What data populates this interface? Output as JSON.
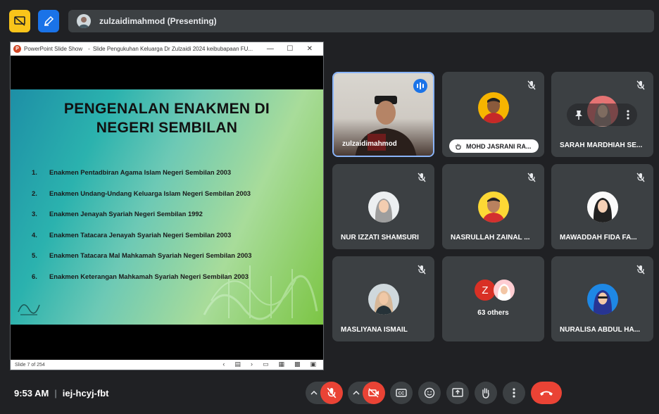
{
  "header": {
    "presenting_title": "zulzaidimahmod (Presenting)"
  },
  "ppt_window": {
    "app_name": "PowerPoint Slide Show",
    "doc_title": "Slide Pengukuhan Keluarga Dr Zulzaidi 2024 keibubapaan FU...",
    "minimize": "—",
    "maximize": "☐",
    "close": "✕",
    "status": "Slide 7 of 254"
  },
  "slide": {
    "title_line1": "PENGENALAN ENAKMEN DI",
    "title_line2": "NEGERI SEMBILAN",
    "items": [
      {
        "num": "1.",
        "text": "Enakmen Pentadbiran Agama Islam Negeri Sembilan 2003"
      },
      {
        "num": "2.",
        "text": "Enakmen Undang-Undang Keluarga Islam Negeri Sembilan 2003"
      },
      {
        "num": "3.",
        "text": "Enakmen Jenayah Syariah Negeri Sembilan 1992"
      },
      {
        "num": "4.",
        "text": "Enakmen Tatacara Jenayah Syariah Negeri Sembilan 2003"
      },
      {
        "num": "5.",
        "text": "Enakmen Tatacara Mal Mahkamah Syariah Negeri Sembilan 2003"
      },
      {
        "num": "6.",
        "text": "Enakmen Keterangan Mahkamah Syariah Negeri Sembilan 2003"
      }
    ]
  },
  "participants": [
    {
      "name": "zulzaidimahmod"
    },
    {
      "name": "MOHD JASRANI RA..."
    },
    {
      "name": "SARAH MARDHIAH SE..."
    },
    {
      "name": "NUR IZZATI SHAMSURI"
    },
    {
      "name": "NASRULLAH ZAINAL ..."
    },
    {
      "name": "MAWADDAH FIDA FA..."
    },
    {
      "name": "MASLIYANA ISMAIL"
    },
    {
      "name": "63 others",
      "initial": "Z"
    },
    {
      "name": "NURALISA ABDUL HA..."
    }
  ],
  "footer": {
    "time": "9:53 AM",
    "separator": "|",
    "meeting_code": "iej-hcyj-fbt"
  },
  "colors": {
    "background": "#202124",
    "tile": "#3c4043",
    "accent_blue": "#1a73e8",
    "danger_red": "#ea4335",
    "highlight_yellow": "#f9c41a"
  }
}
